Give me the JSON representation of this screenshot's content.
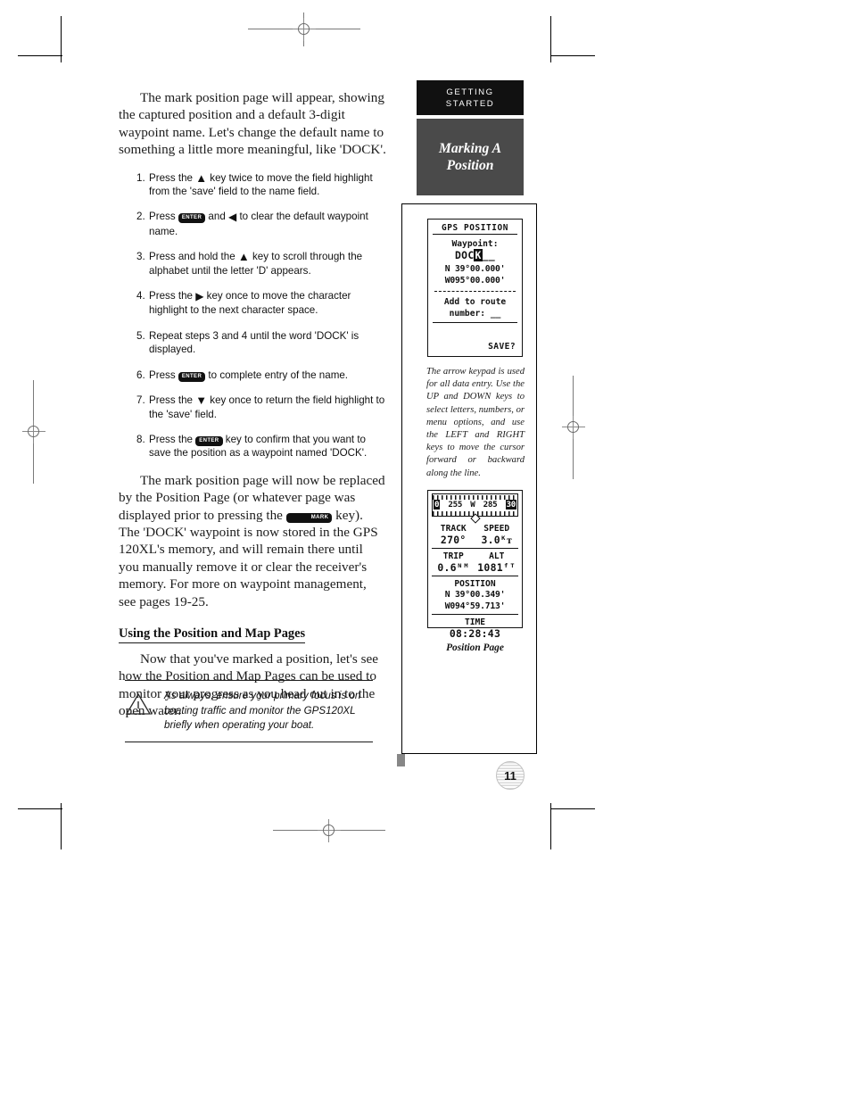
{
  "document": {
    "page_number": "11",
    "sidebar": {
      "section_tab_line1": "GETTING",
      "section_tab_line2": "STARTED",
      "topic_line1": "Marking A",
      "topic_line2": "Position"
    }
  },
  "main": {
    "intro_paragraph": "The mark position page will appear, showing the captured position and a default 3-digit waypoint name. Let's change the default name to something a little more meaningful, like 'DOCK'.",
    "steps": [
      {
        "num": "1.",
        "parts": [
          {
            "t": "text",
            "v": "Press the "
          },
          {
            "t": "icon",
            "v": "arrow-up"
          },
          {
            "t": "text",
            "v": " key twice to move the field highlight from the 'save' field to the name field."
          }
        ]
      },
      {
        "num": "2.",
        "parts": [
          {
            "t": "text",
            "v": "Press "
          },
          {
            "t": "key",
            "v": "ENTER"
          },
          {
            "t": "text",
            "v": " and "
          },
          {
            "t": "icon",
            "v": "arrow-left"
          },
          {
            "t": "text",
            "v": " to clear the default waypoint name."
          }
        ]
      },
      {
        "num": "3.",
        "parts": [
          {
            "t": "text",
            "v": "Press and hold the "
          },
          {
            "t": "icon",
            "v": "arrow-up"
          },
          {
            "t": "text",
            "v": " key to scroll through the alphabet until the letter 'D' appears."
          }
        ]
      },
      {
        "num": "4.",
        "parts": [
          {
            "t": "text",
            "v": "Press the "
          },
          {
            "t": "icon",
            "v": "arrow-right"
          },
          {
            "t": "text",
            "v": " key once to move the character highlight to the next character space."
          }
        ]
      },
      {
        "num": "5.",
        "parts": [
          {
            "t": "text",
            "v": "Repeat steps 3 and 4 until the word 'DOCK' is displayed."
          }
        ]
      },
      {
        "num": "6.",
        "parts": [
          {
            "t": "text",
            "v": "Press "
          },
          {
            "t": "key",
            "v": "ENTER"
          },
          {
            "t": "text",
            "v": " to complete entry of the name."
          }
        ]
      },
      {
        "num": "7.",
        "parts": [
          {
            "t": "text",
            "v": "Press the "
          },
          {
            "t": "icon",
            "v": "arrow-down"
          },
          {
            "t": "text",
            "v": " key once to return the field highlight to the 'save' field."
          }
        ]
      },
      {
        "num": "8.",
        "parts": [
          {
            "t": "text",
            "v": "Press the "
          },
          {
            "t": "key",
            "v": "ENTER"
          },
          {
            "t": "text",
            "v": " key to confirm that you want to save the position as a waypoint named 'DOCK'."
          }
        ]
      }
    ],
    "after_steps_paragraph_parts": [
      {
        "t": "text",
        "v": "The mark position page will now be replaced by the Position Page (or whatever page was displayed prior to pressing the "
      },
      {
        "t": "key",
        "v": "MARK"
      },
      {
        "t": "text",
        "v": " key). The 'DOCK' waypoint is now stored in the GPS 120XL's memory, and will remain there until you manually remove it or clear the receiver's memory. For more on waypoint management, see pages 19-25."
      }
    ],
    "section_heading": "Using the Position and Map Pages",
    "closing_paragraph": "Now that you've marked a position, let's see how the Position and Map Pages can be used to monitor your progress as you head out in to the open water.",
    "warning": {
      "icon": "warning-triangle-icon",
      "text": "As always, ensure your primary focus is on boating traffic and monitor the GPS120XL briefly when operating your boat."
    }
  },
  "figures": {
    "mark_position_screen": {
      "title": "GPS POSITION",
      "waypoint_label": "Waypoint:",
      "waypoint_name_prefix": "DOC",
      "waypoint_name_highlighted": "K",
      "waypoint_name_blanks": "__",
      "lat": "N  39°00.000'",
      "lon": "W095°00.000'",
      "route_label_line1": "Add to route",
      "route_label_line2": "number: __",
      "save_label": "SAVE?"
    },
    "mark_position_caption": "The arrow keypad is used for all data entry. Use the UP and DOWN keys to select letters, numbers, or menu options, and use the LEFT and RIGHT keys to move the cursor forward or backward along the line.",
    "position_page_screen": {
      "compass_left": "0",
      "compass_mid_left": "255",
      "compass_center": "W",
      "compass_mid_right": "285",
      "compass_right": "30",
      "track_label": "TRACK",
      "track_value": "270°",
      "speed_label": "SPEED",
      "speed_value": "3.0ᴷᴛ",
      "trip_label": "TRIP",
      "trip_value": "0.6ᴺᴹ",
      "alt_label": "ALT",
      "alt_value": "1081ᶠᵀ",
      "position_label": "POSITION",
      "position_lat": "N  39°00.349'",
      "position_lon": "W094°59.713'",
      "time_label": "TIME",
      "time_value": "08:28:43"
    },
    "position_page_caption": "Position Page"
  }
}
